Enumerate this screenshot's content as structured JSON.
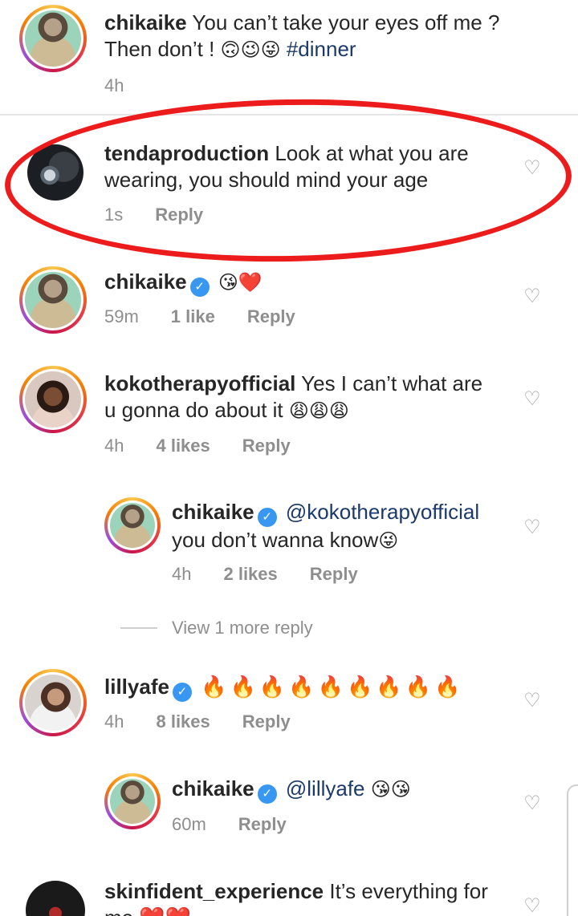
{
  "caption": {
    "username": "chikaike",
    "text": "You can’t take your eyes off me ?",
    "text_line2": "Then don’t !",
    "emojis": "🙃😉😜",
    "hashtag": "#dinner",
    "time": "4h"
  },
  "comments": [
    {
      "username": "tendaproduction",
      "text": "Look at what you are",
      "text_line2": "wearing, you should mind your age",
      "time": "1s",
      "reply": "Reply"
    },
    {
      "username": "chikaike",
      "emoji_text": "😘❤️",
      "time": "59m",
      "likes": "1 like",
      "reply": "Reply"
    },
    {
      "username": "kokotherapyofficial",
      "text": "Yes I can’t what are",
      "text_line2": "u gonna do about it",
      "emojis": "😩😩😩",
      "time": "4h",
      "likes": "4 likes",
      "reply": "Reply"
    },
    {
      "username": "chikaike",
      "mention": "@kokotherapyofficial",
      "text_line2": "you don’t wanna know",
      "emojis": "😜",
      "time": "4h",
      "likes": "2 likes",
      "reply": "Reply"
    },
    {
      "username": "lillyafe",
      "emojis": "🔥🔥🔥🔥🔥🔥🔥🔥🔥",
      "time": "4h",
      "likes": "8 likes",
      "reply": "Reply"
    },
    {
      "username": "chikaike",
      "mention": "@lillyafe",
      "emojis": "😘😘",
      "time": "60m",
      "reply": "Reply"
    },
    {
      "username": "skinfident_experience",
      "text": "It’s everything for",
      "text_line2": "me",
      "emojis": "❤️❤️"
    }
  ],
  "view_more_replies": "View 1 more reply",
  "icons": {
    "heart": "heart-outline-icon",
    "verified": "verified-badge-icon"
  },
  "colors": {
    "highlight": "#ed1c1c",
    "link": "#1b3a6b",
    "meta": "#8e8e8e",
    "verified": "#3897f0"
  }
}
